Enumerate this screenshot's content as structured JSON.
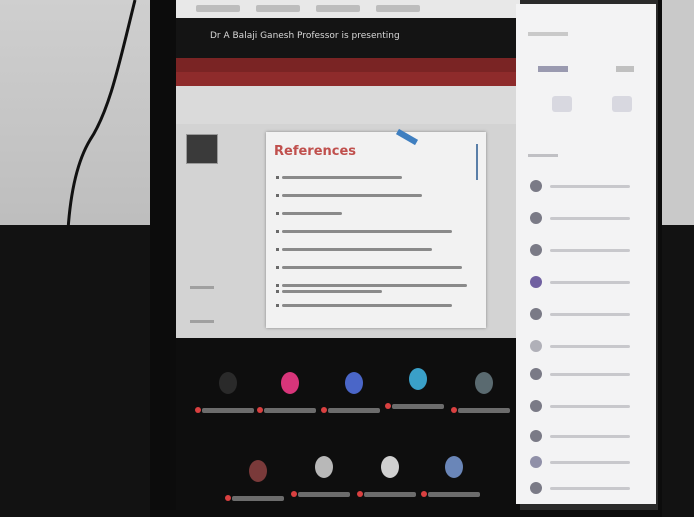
{
  "meeting": {
    "presenter_banner": "Dr A Balaji Ganesh Professor is presenting"
  },
  "slide": {
    "title": "References"
  },
  "colors": {
    "slide_title": "#c0504d",
    "ribbon": "#8e2b2b",
    "panel_bg": "#f3f3f4"
  },
  "icons": {
    "mute": "microphone-off-icon"
  }
}
